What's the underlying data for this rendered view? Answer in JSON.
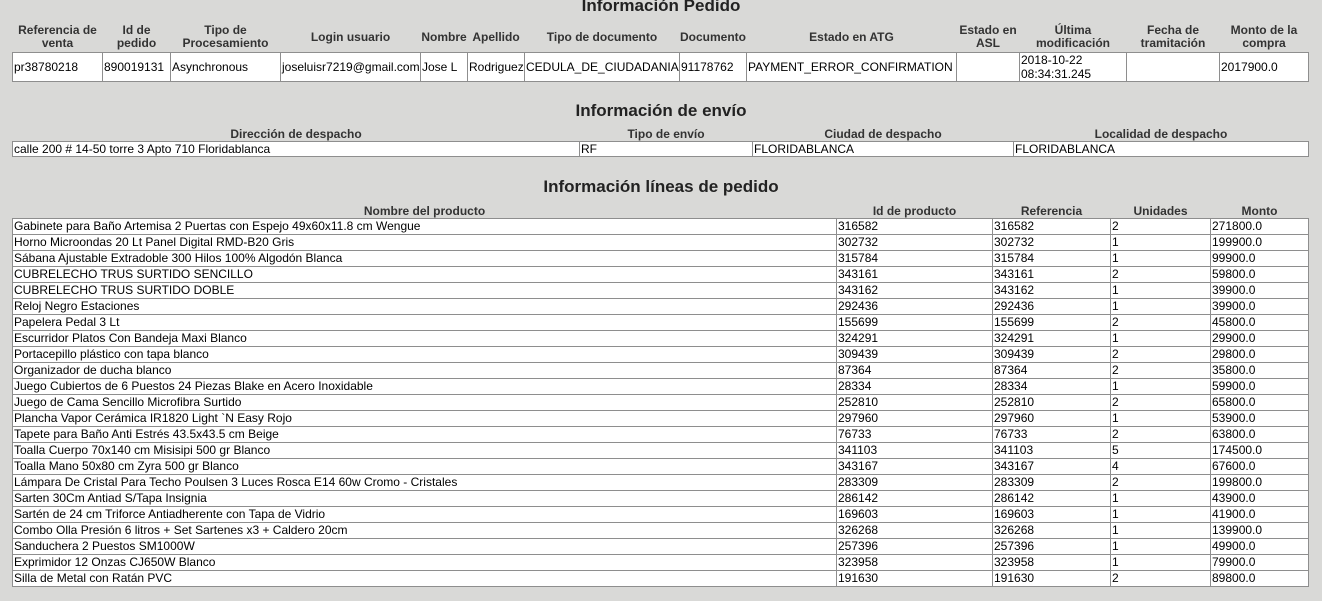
{
  "order": {
    "title": "Información Pedido",
    "headers": [
      "Referencia de venta",
      "Id de pedido",
      "Tipo de Procesamiento",
      "Login usuario",
      "Nombre",
      "Apellido",
      "Tipo de documento",
      "Documento",
      "Estado en ATG",
      "Estado en ASL",
      "Última modificación",
      "Fecha de tramitación",
      "Monto de la compra"
    ],
    "row": [
      "pr38780218",
      "890019131",
      "Asynchronous",
      "joseluisr7219@gmail.com",
      "Jose L",
      "Rodriguez",
      "CEDULA_DE_CIUDADANIA",
      "91178762",
      "PAYMENT_ERROR_CONFIRMATION",
      "",
      "2018-10-22 08:34:31.245",
      "",
      "2017900.0"
    ]
  },
  "shipping": {
    "title": "Información de envío",
    "headers": [
      "Dirección de despacho",
      "Tipo de envío",
      "Ciudad de despacho",
      "Localidad de despacho"
    ],
    "row": [
      "calle 200 # 14-50 torre 3 Apto 710 Floridablanca",
      "RF",
      "FLORIDABLANCA",
      "FLORIDABLANCA"
    ]
  },
  "lines": {
    "title": "Información líneas de pedido",
    "headers": [
      "Nombre del producto",
      "Id de producto",
      "Referencia",
      "Unidades",
      "Monto"
    ],
    "rows": [
      [
        "Gabinete para Baño Artemisa 2 Puertas con Espejo 49x60x11.8 cm Wengue",
        "316582",
        "316582",
        "2",
        "271800.0"
      ],
      [
        "Horno Microondas 20 Lt Panel Digital RMD-B20 Gris",
        "302732",
        "302732",
        "1",
        "199900.0"
      ],
      [
        "Sábana Ajustable Extradoble 300 Hilos 100% Algodón Blanca",
        "315784",
        "315784",
        "1",
        "99900.0"
      ],
      [
        "CUBRELECHO TRUS SURTIDO SENCILLO",
        "343161",
        "343161",
        "2",
        "59800.0"
      ],
      [
        "CUBRELECHO TRUS SURTIDO DOBLE",
        "343162",
        "343162",
        "1",
        "39900.0"
      ],
      [
        "Reloj Negro Estaciones",
        "292436",
        "292436",
        "1",
        "39900.0"
      ],
      [
        "Papelera Pedal 3 Lt",
        "155699",
        "155699",
        "2",
        "45800.0"
      ],
      [
        "Escurridor Platos Con Bandeja Maxi Blanco",
        "324291",
        "324291",
        "1",
        "29900.0"
      ],
      [
        "Portacepillo plástico con tapa blanco",
        "309439",
        "309439",
        "2",
        "29800.0"
      ],
      [
        "Organizador de ducha blanco",
        "87364",
        "87364",
        "2",
        "35800.0"
      ],
      [
        "Juego Cubiertos de 6 Puestos 24 Piezas Blake en Acero Inoxidable",
        "28334",
        "28334",
        "1",
        "59900.0"
      ],
      [
        "Juego de Cama Sencillo Microfibra Surtido",
        "252810",
        "252810",
        "2",
        "65800.0"
      ],
      [
        "Plancha Vapor Cerámica IR1820 Light `N Easy Rojo",
        "297960",
        "297960",
        "1",
        "53900.0"
      ],
      [
        "Tapete para Baño Anti Estrés 43.5x43.5 cm Beige",
        "76733",
        "76733",
        "2",
        "63800.0"
      ],
      [
        "Toalla Cuerpo 70x140 cm Misisipi 500 gr Blanco",
        "341103",
        "341103",
        "5",
        "174500.0"
      ],
      [
        "Toalla Mano 50x80 cm Zyra 500 gr Blanco",
        "343167",
        "343167",
        "4",
        "67600.0"
      ],
      [
        "Lámpara De Cristal Para Techo Poulsen 3 Luces Rosca E14 60w Cromo - Cristales",
        "283309",
        "283309",
        "2",
        "199800.0"
      ],
      [
        "Sarten 30Cm Antiad S/Tapa Insignia",
        "286142",
        "286142",
        "1",
        "43900.0"
      ],
      [
        "Sartén de 24 cm Triforce Antiadherente con Tapa de Vidrio",
        "169603",
        "169603",
        "1",
        "41900.0"
      ],
      [
        "Combo Olla Presión 6 litros + Set Sartenes x3 + Caldero 20cm",
        "326268",
        "326268",
        "1",
        "139900.0"
      ],
      [
        "Sanduchera 2 Puestos SM1000W",
        "257396",
        "257396",
        "1",
        "49900.0"
      ],
      [
        "Exprimidor 12 Onzas CJ650W Blanco",
        "323958",
        "323958",
        "1",
        "79900.0"
      ],
      [
        "Silla de Metal con Ratán PVC",
        "191630",
        "191630",
        "2",
        "89800.0"
      ]
    ]
  }
}
